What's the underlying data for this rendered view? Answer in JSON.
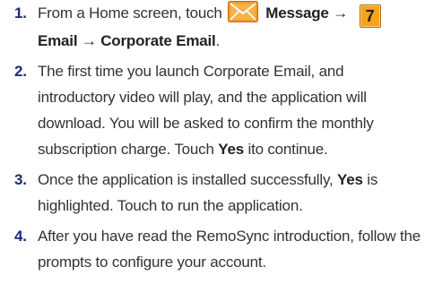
{
  "steps": [
    {
      "number": "1.",
      "lead": "From a Home screen, touch",
      "message_label": "Message",
      "arrow1": "→",
      "email_key_label": "7",
      "email_label": "Email",
      "arrow2": "→",
      "corporate_email_label": "Corporate Email",
      "end": "."
    },
    {
      "number": "2.",
      "text_before": "The first time you launch Corporate Email, and introductory video will play, and the application will download.  You will be asked to confirm the monthly subscription charge. Touch",
      "yes_label": "Yes",
      "text_after": "ito continue."
    },
    {
      "number": "3.",
      "text_before": "Once the application is installed successfully,",
      "yes_label": "Yes",
      "text_after": "is highlighted. Touch to run the application."
    },
    {
      "number": "4.",
      "text": "After you have read the RemoSync introduction, follow the prompts to configure your account."
    }
  ],
  "icons": {
    "message": "envelope-icon",
    "email_key": "number-key-icon"
  },
  "colors": {
    "envelope_bg": "#f39a2b",
    "envelope_lines": "#ffffff",
    "number_key_bg": "#f7a21e",
    "step_number": "#1e2a78",
    "text": "#333333"
  }
}
